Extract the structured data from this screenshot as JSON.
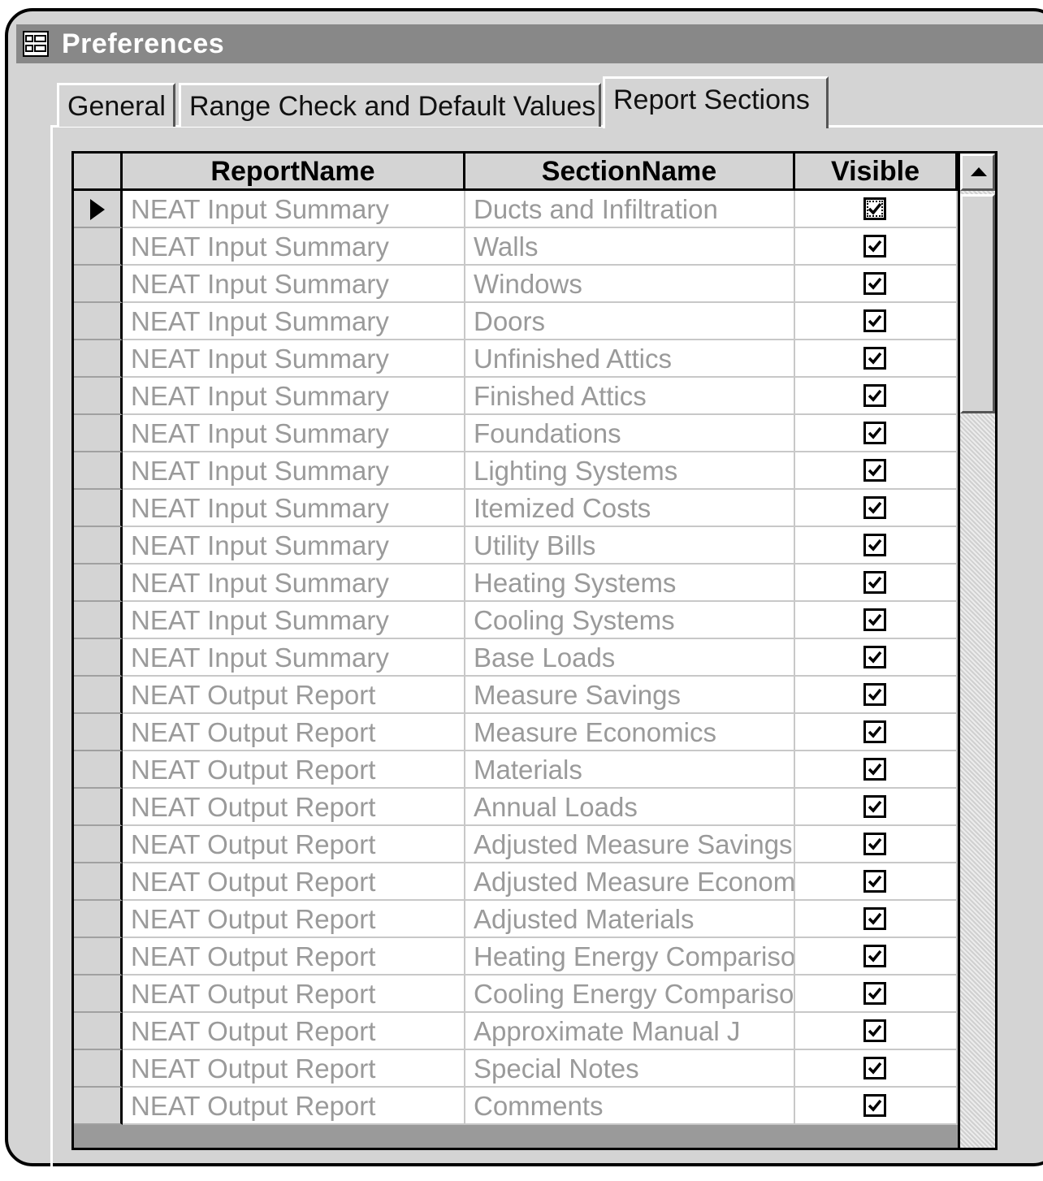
{
  "window": {
    "title": "Preferences",
    "icon": "form-icon"
  },
  "tabs": [
    {
      "label": "General",
      "active": false
    },
    {
      "label": "Range Check and Default Values",
      "active": false
    },
    {
      "label": "Report Sections",
      "active": true
    }
  ],
  "grid": {
    "columns": [
      "ReportName",
      "SectionName",
      "Visible"
    ],
    "rows": [
      {
        "report": "NEAT Input Summary",
        "section": "Ducts and Infiltration",
        "visible": true
      },
      {
        "report": "NEAT Input Summary",
        "section": "Walls",
        "visible": true
      },
      {
        "report": "NEAT Input Summary",
        "section": "Windows",
        "visible": true
      },
      {
        "report": "NEAT Input Summary",
        "section": "Doors",
        "visible": true
      },
      {
        "report": "NEAT Input Summary",
        "section": "Unfinished Attics",
        "visible": true
      },
      {
        "report": "NEAT Input Summary",
        "section": "Finished Attics",
        "visible": true
      },
      {
        "report": "NEAT Input Summary",
        "section": "Foundations",
        "visible": true
      },
      {
        "report": "NEAT Input Summary",
        "section": "Lighting Systems",
        "visible": true
      },
      {
        "report": "NEAT Input Summary",
        "section": "Itemized Costs",
        "visible": true
      },
      {
        "report": "NEAT Input Summary",
        "section": "Utility Bills",
        "visible": true
      },
      {
        "report": "NEAT Input Summary",
        "section": "Heating Systems",
        "visible": true
      },
      {
        "report": "NEAT Input Summary",
        "section": "Cooling Systems",
        "visible": true
      },
      {
        "report": "NEAT Input Summary",
        "section": "Base Loads",
        "visible": true
      },
      {
        "report": "NEAT Output Report",
        "section": "Measure Savings",
        "visible": true
      },
      {
        "report": "NEAT Output Report",
        "section": "Measure Economics",
        "visible": true
      },
      {
        "report": "NEAT Output Report",
        "section": "Materials",
        "visible": true
      },
      {
        "report": "NEAT Output Report",
        "section": "Annual Loads",
        "visible": true
      },
      {
        "report": "NEAT Output Report",
        "section": "Adjusted Measure Savings",
        "visible": true
      },
      {
        "report": "NEAT Output Report",
        "section": "Adjusted Measure Econom",
        "visible": true
      },
      {
        "report": "NEAT Output Report",
        "section": "Adjusted Materials",
        "visible": true
      },
      {
        "report": "NEAT Output Report",
        "section": "Heating Energy Comparisoı",
        "visible": true
      },
      {
        "report": "NEAT Output Report",
        "section": "Cooling Energy Comparisor",
        "visible": true
      },
      {
        "report": "NEAT Output Report",
        "section": "Approximate Manual J",
        "visible": true
      },
      {
        "report": "NEAT Output Report",
        "section": "Special Notes",
        "visible": true
      },
      {
        "report": "NEAT Output Report",
        "section": "Comments",
        "visible": true
      }
    ],
    "current_row": 0
  },
  "scrollbar": {
    "up_icon": "scroll-up-arrow-icon"
  }
}
